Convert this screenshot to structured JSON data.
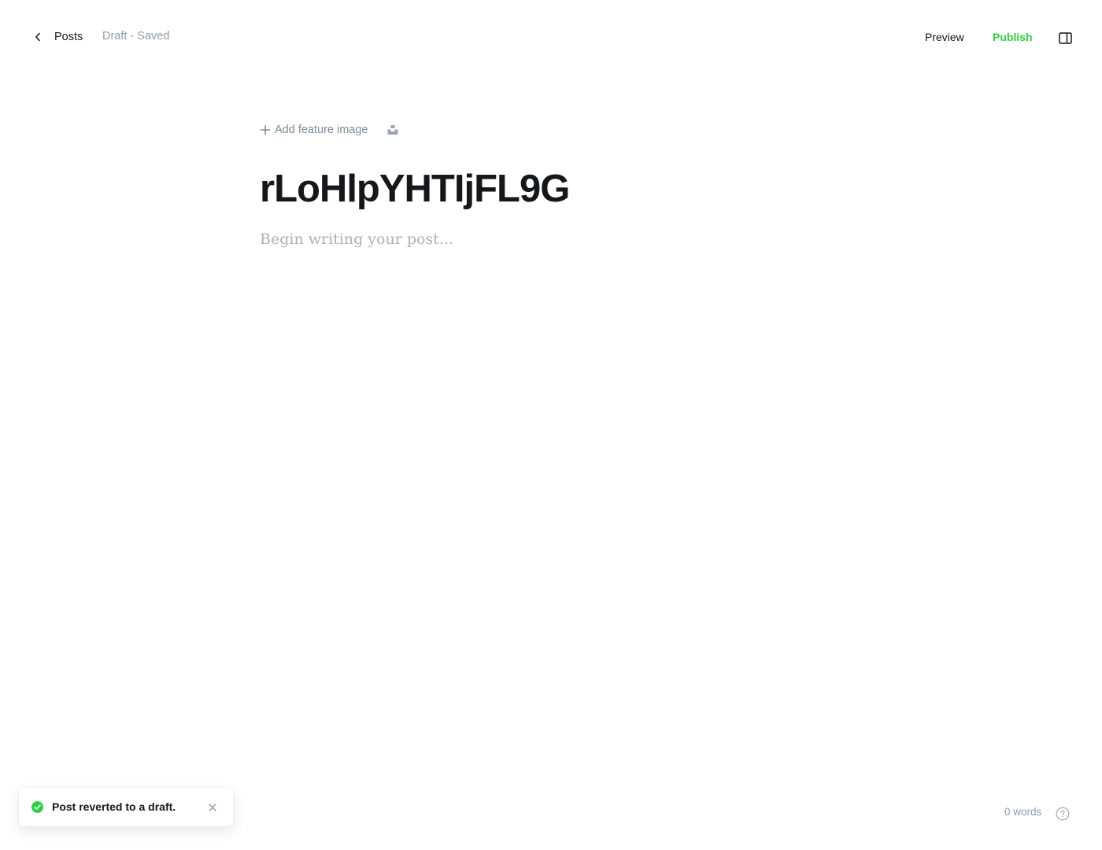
{
  "header": {
    "back_label": "Posts",
    "status": "Draft - Saved",
    "preview_label": "Preview",
    "publish_label": "Publish",
    "publish_color": "#30cf43"
  },
  "editor": {
    "add_feature_image_label": "Add feature image",
    "title": "rLoHlpYHTIjFL9G",
    "body_placeholder": "Begin writing your post..."
  },
  "toast": {
    "message": "Post reverted to a draft.",
    "status_color": "#30cf43"
  },
  "footer": {
    "word_count": "0 words"
  },
  "icons": {
    "back": "chevron-left-icon",
    "sidebar": "sidebar-toggle-icon",
    "add": "plus-icon",
    "unsplash": "unsplash-icon",
    "success": "check-circle-icon",
    "close": "close-icon",
    "help": "question-circle-icon"
  }
}
